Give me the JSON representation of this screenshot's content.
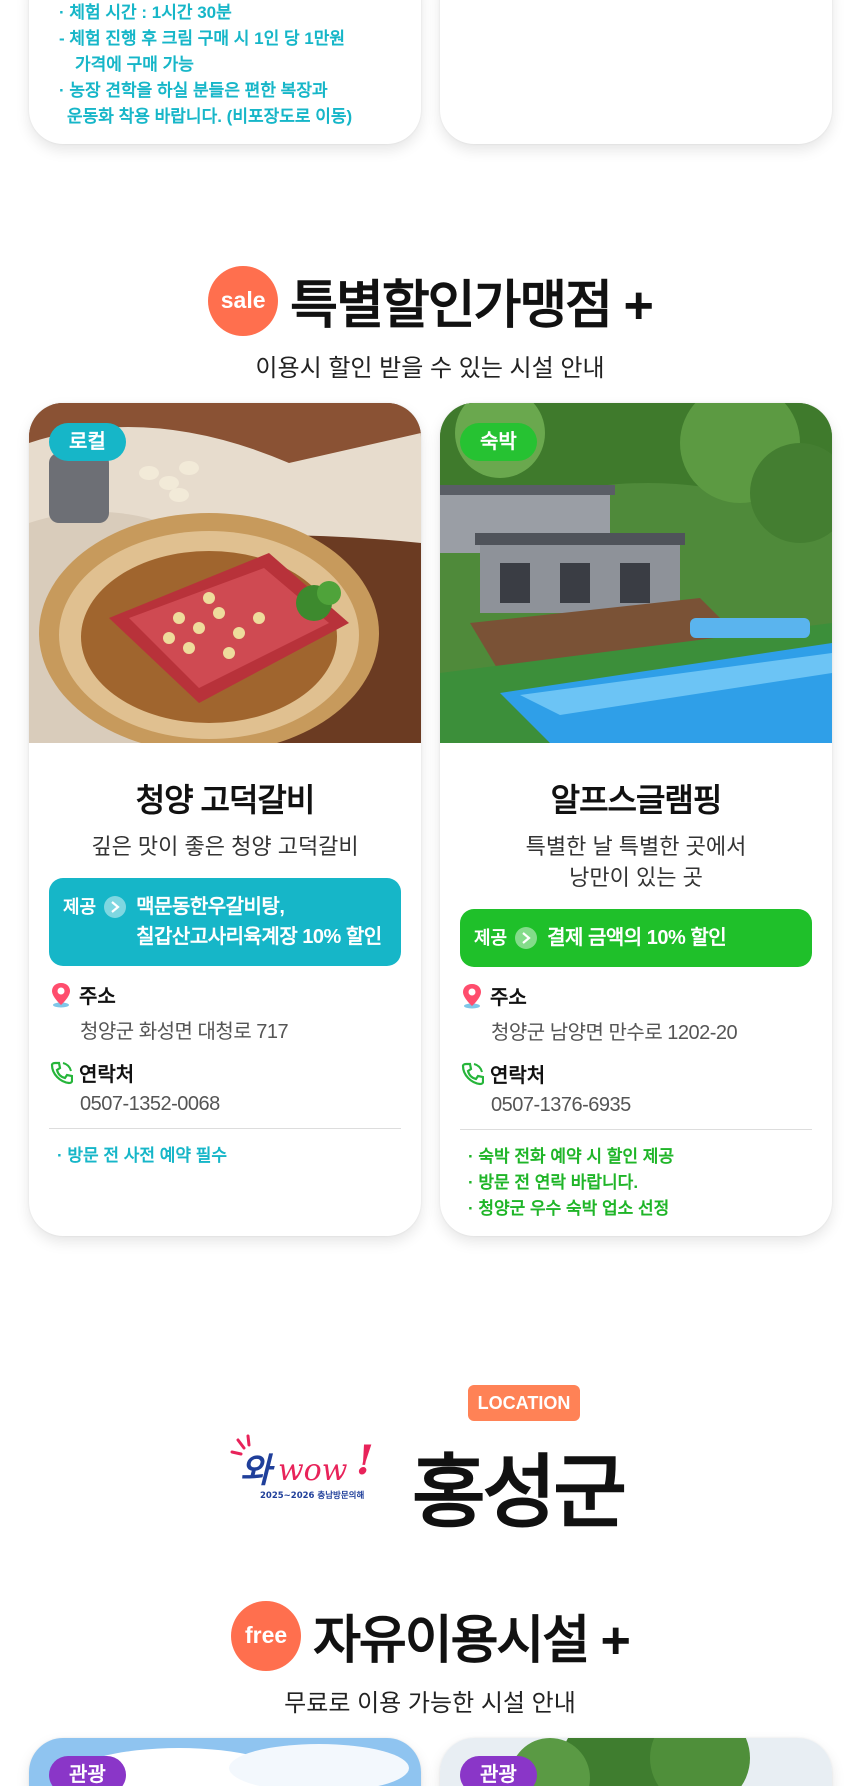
{
  "top_notes": [
    "· 체험 시간 : 1시간 30분",
    "- 체험 진행 후 크림 구매 시 1인 당 1만원",
    "  가격에 구매 가능",
    "· 농장 견학을 하실 분들은 편한 복장과",
    "  운동화 착용 바랍니다. (비포장도로 이동)"
  ],
  "sale_section": {
    "badge": "sale",
    "title": "특별할인가맹점 +",
    "subtitle": "이용시 할인 받을 수 있는 시설 안내"
  },
  "facilities": [
    {
      "tag": "로컬",
      "name": "청양 고덕갈비",
      "desc": [
        "깊은 맛이 좋은 청양 고덕갈비"
      ],
      "offer_label": "제공",
      "offer_lines": [
        "맥문동한우갈비탕,",
        "칠갑산고사리육계장 10% 할인"
      ],
      "address_label": "주소",
      "address": "청양군 화성면 대청로 717",
      "contact_label": "연락처",
      "contact": "0507-1352-0068",
      "notes": [
        "· 방문 전 사전 예약 필수"
      ]
    },
    {
      "tag": "숙박",
      "name": "알프스글램핑",
      "desc": [
        "특별한 날 특별한 곳에서",
        "낭만이 있는 곳"
      ],
      "offer_label": "제공",
      "offer_lines": [
        "결제 금액의 10% 할인"
      ],
      "address_label": "주소",
      "address": "청양군 남양면 만수로 1202-20",
      "contact_label": "연락처",
      "contact": "0507-1376-6935",
      "notes": [
        "· 숙박 전화 예약 시 할인 제공",
        "· 방문 전 연락 바랍니다.",
        "· 청양군 우수 숙박 업소 선정"
      ]
    }
  ],
  "location": {
    "badge": "LOCATION",
    "logo_text": "와wow!",
    "logo_sub": "2025~2026 충남방문의해",
    "region": "홍성군"
  },
  "free_section": {
    "badge": "free",
    "title": "자유이용시설 +",
    "subtitle": "무료로 이용 가능한 시설 안내"
  },
  "bottom_tags": [
    "관광",
    "관광"
  ],
  "colors": {
    "cyan": "#16b6c8",
    "green": "#1fc02a",
    "orange": "#ff6f4e",
    "purple": "#8a36c8"
  }
}
